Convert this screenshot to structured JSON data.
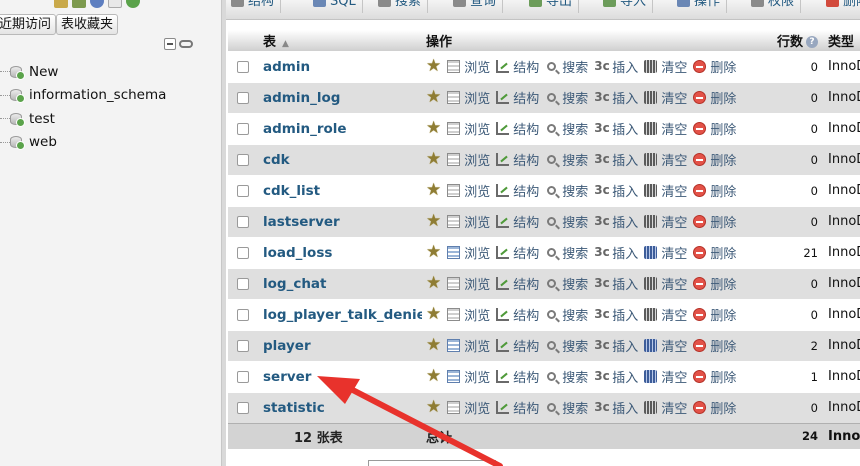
{
  "nav": {
    "buttons": {
      "recent": "近期访问",
      "favorites": "表收藏夹"
    },
    "databases": [
      {
        "label": "New"
      },
      {
        "label": "information_schema"
      },
      {
        "label": "test"
      },
      {
        "label": "web"
      }
    ]
  },
  "tabs": [
    "结构",
    "SQL",
    "搜索",
    "查询",
    "导出",
    "导入",
    "操作",
    "权限",
    "删除"
  ],
  "table": {
    "headers": {
      "table": "表",
      "action": "操作",
      "rows": "行数",
      "type": "类型"
    },
    "action_labels": {
      "browse": "浏览",
      "structure": "结构",
      "search": "搜索",
      "insert": "插入",
      "empty": "清空",
      "drop": "删除"
    },
    "rows": [
      {
        "name": "admin",
        "rows": "0",
        "type": "InnoDB"
      },
      {
        "name": "admin_log",
        "rows": "0",
        "type": "InnoDB"
      },
      {
        "name": "admin_role",
        "rows": "0",
        "type": "InnoDB"
      },
      {
        "name": "cdk",
        "rows": "0",
        "type": "InnoDB"
      },
      {
        "name": "cdk_list",
        "rows": "0",
        "type": "InnoDB"
      },
      {
        "name": "lastserver",
        "rows": "0",
        "type": "InnoDB"
      },
      {
        "name": "load_loss",
        "rows": "21",
        "type": "InnoDB"
      },
      {
        "name": "log_chat",
        "rows": "0",
        "type": "InnoDB"
      },
      {
        "name": "log_player_talk_denied",
        "rows": "0",
        "type": "InnoDB"
      },
      {
        "name": "player",
        "rows": "2",
        "type": "InnoDB"
      },
      {
        "name": "server",
        "rows": "1",
        "type": "InnoDB"
      },
      {
        "name": "statistic",
        "rows": "0",
        "type": "InnoDB"
      }
    ],
    "footer": {
      "count": "12 张表",
      "total_label": "总计",
      "total_rows": "24",
      "type": "InnoDB"
    }
  },
  "colors": {
    "link": "#235a81",
    "arrow": "#e8322c"
  }
}
